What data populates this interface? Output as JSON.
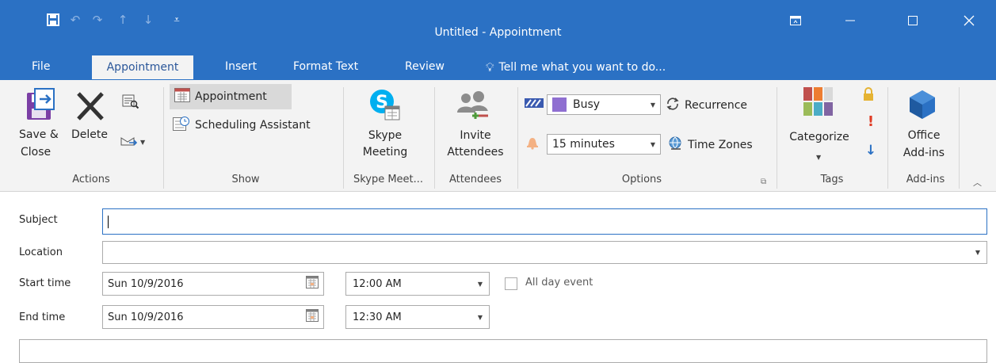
{
  "window": {
    "title": "Untitled - Appointment"
  },
  "tabs": [
    {
      "label": "File"
    },
    {
      "label": "Appointment"
    },
    {
      "label": "Insert"
    },
    {
      "label": "Format Text"
    },
    {
      "label": "Review"
    }
  ],
  "tellme": "Tell me what you want to do...",
  "ribbon": {
    "actions": {
      "save_line1": "Save &",
      "save_line2": "Close",
      "delete": "Delete",
      "label": "Actions"
    },
    "show": {
      "appointment": "Appointment",
      "scheduling": "Scheduling Assistant",
      "label": "Show"
    },
    "skype": {
      "line1": "Skype",
      "line2": "Meeting",
      "label": "Skype Meet..."
    },
    "attendees": {
      "line1": "Invite",
      "line2": "Attendees",
      "label": "Attendees"
    },
    "options": {
      "show_as": "Busy",
      "reminder": "15 minutes",
      "recurrence": "Recurrence",
      "timezones": "Time Zones",
      "label": "Options"
    },
    "tags": {
      "categorize": "Categorize",
      "label": "Tags"
    },
    "addins": {
      "line1": "Office",
      "line2": "Add-ins",
      "label": "Add-ins"
    }
  },
  "form": {
    "subject_label": "Subject",
    "subject_value": "",
    "location_label": "Location",
    "location_value": "",
    "start_label": "Start time",
    "start_date": "Sun 10/9/2016",
    "start_time": "12:00 AM",
    "end_label": "End time",
    "end_date": "Sun 10/9/2016",
    "end_time": "12:30 AM",
    "allday_label": "All day event"
  },
  "colors": {
    "accent": "#2b71c4",
    "ribbon": "#f3f3f3",
    "focus_border": "#2b71c4"
  }
}
